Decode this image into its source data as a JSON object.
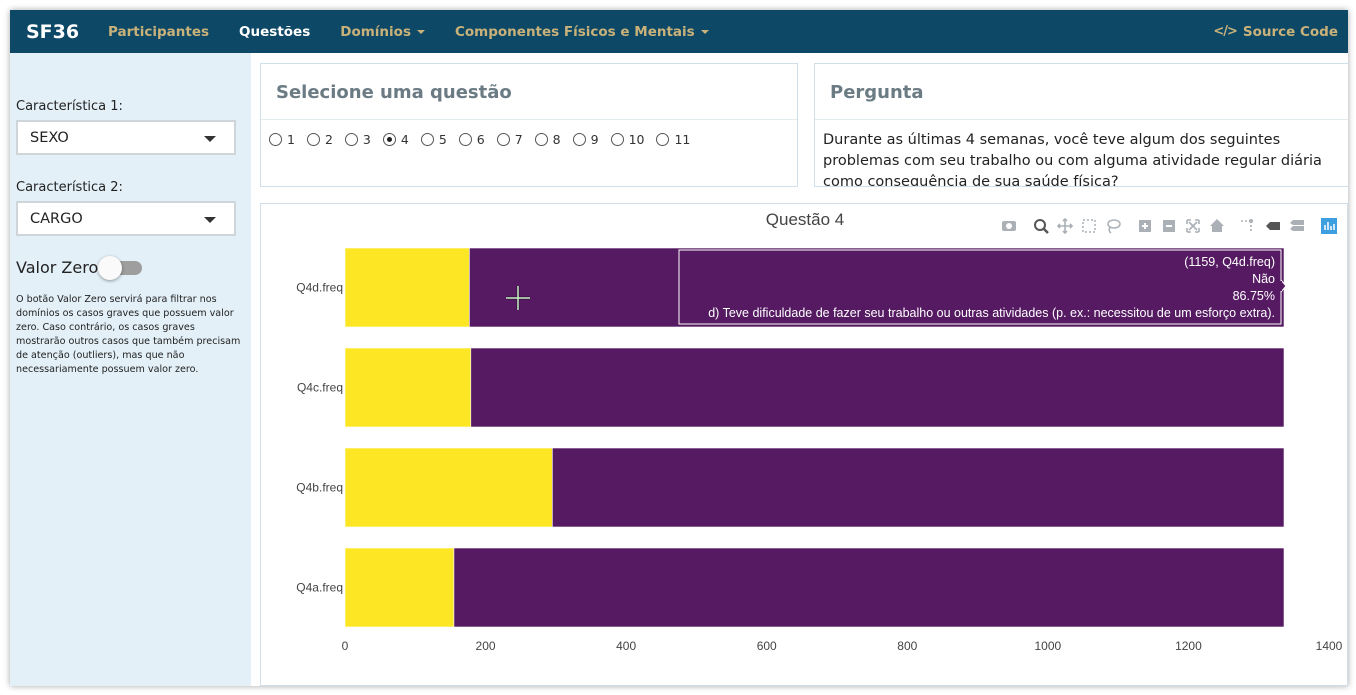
{
  "navbar": {
    "brand": "SF36",
    "items": [
      {
        "label": "Participantes",
        "active": false,
        "dropdown": false
      },
      {
        "label": "Questões",
        "active": true,
        "dropdown": false
      },
      {
        "label": "Domínios",
        "active": false,
        "dropdown": true
      },
      {
        "label": "Componentes Físicos e Mentais",
        "active": false,
        "dropdown": true
      }
    ],
    "source_code": "Source Code",
    "source_code_icon": "code-icon"
  },
  "sidebar": {
    "char1_label": "Característica 1:",
    "char1_value": "SEXO",
    "char2_label": "Característica 2:",
    "char2_value": "CARGO",
    "valor_zero_label": "Valor Zero",
    "valor_zero_on": false,
    "help_text": "O botão Valor Zero servirá para filtrar nos domínios os casos graves que possuem valor zero. Caso contrário, os casos graves mostrarão outros casos que também precisam de atenção (outliers), mas que não necessariamente possuem valor zero."
  },
  "question_panel": {
    "title": "Selecione uma questão",
    "options": [
      "1",
      "2",
      "3",
      "4",
      "5",
      "6",
      "7",
      "8",
      "9",
      "10",
      "11"
    ],
    "selected": "4"
  },
  "pergunta_panel": {
    "title": "Pergunta",
    "text": "Durante as últimas 4 semanas, você teve algum dos seguintes problemas com seu trabalho ou com alguma atividade regular diária como consequência de sua saúde física?"
  },
  "modebar": [
    "camera-icon",
    "zoom-icon",
    "pan-icon",
    "box-select-icon",
    "lasso-icon",
    "zoom-in-icon",
    "zoom-out-icon",
    "autoscale-icon",
    "reset-axes-icon",
    "spike-lines-icon",
    "hover-closest-icon",
    "hover-compare-icon",
    "plotly-logo-icon"
  ],
  "tooltip": {
    "lines": [
      "(1159, Q4d.freq)",
      "Não",
      "86.75%",
      "d) Teve dificuldade de fazer seu trabalho ou outras atividades (p. ex.: necessitou de um esforço extra)."
    ]
  },
  "chart_data": {
    "type": "bar",
    "orientation": "horizontal",
    "barmode": "stack",
    "title": "Questão 4",
    "categories": [
      "Q4d.freq",
      "Q4c.freq",
      "Q4b.freq",
      "Q4a.freq"
    ],
    "series": [
      {
        "color": "#fde725",
        "values": [
          177,
          179,
          295,
          155
        ]
      },
      {
        "color": "#551a62",
        "values": [
          1159,
          1157,
          1041,
          1181
        ]
      }
    ],
    "xlim": [
      0,
      1400
    ],
    "xticks": [
      "0",
      "200",
      "400",
      "600",
      "800",
      "1000",
      "1200",
      "1400"
    ],
    "grid": false,
    "legend": "none"
  }
}
